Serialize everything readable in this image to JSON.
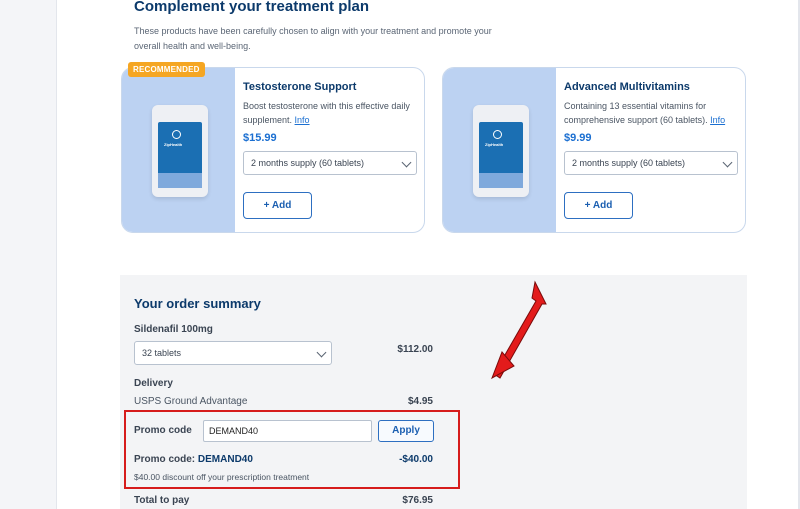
{
  "complement": {
    "title": "Complement your treatment plan",
    "description": "These products have been carefully chosen to align with your treatment and promote your overall health and well-being.",
    "badge": "RECOMMENDED",
    "products": [
      {
        "name": "Testosterone Support",
        "description": "Boost testosterone with this effective daily supplement.",
        "info_link": "Info",
        "price": "$15.99",
        "supply_option": "2 months supply (60 tablets)",
        "add_label": "+ Add",
        "pouch_brand": "ZipHealth"
      },
      {
        "name": "Advanced Multivitamins",
        "description": "Containing 13 essential vitamins for comprehensive support (60 tablets).",
        "info_link": "Info",
        "price": "$9.99",
        "supply_option": "2 months supply (60 tablets)",
        "add_label": "+ Add",
        "pouch_brand": "ZipHealth"
      }
    ]
  },
  "summary": {
    "title": "Your order summary",
    "medication": {
      "name": "Sildenafil 100mg",
      "quantity_option": "32 tablets",
      "price": "$112.00"
    },
    "delivery": {
      "label": "Delivery",
      "method": "USPS Ground Advantage",
      "price": "$4.95"
    },
    "promo": {
      "label": "Promo code",
      "input_value": "DEMAND40",
      "apply_label": "Apply",
      "applied_prefix": "Promo code:",
      "applied_code": "DEMAND40",
      "discount": "-$40.00",
      "discount_note": "$40.00 discount off your prescription treatment"
    },
    "total": {
      "label": "Total to pay",
      "amount": "$76.95"
    }
  },
  "colors": {
    "brand_navy": "#0c3a6b",
    "accent_blue": "#1b6fd1",
    "badge_orange": "#f5a623",
    "highlight_red": "#d61c1c",
    "card_image_bg": "#bcd2f2"
  }
}
